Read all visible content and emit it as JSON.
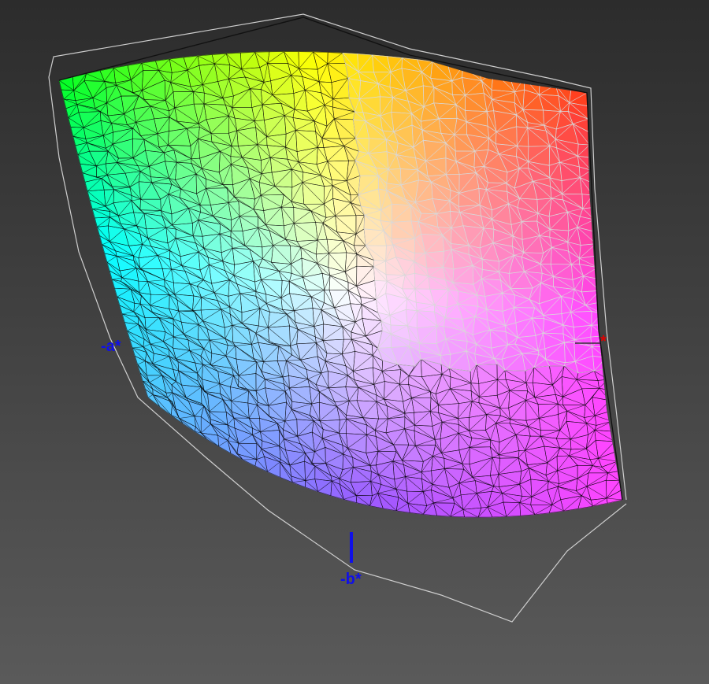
{
  "axis_labels": {
    "neg_a": "-a*",
    "pos_a": "*",
    "neg_b": "-b*"
  },
  "colors": {
    "axis": "#1010e8",
    "background_top": "#2c2c2c",
    "background_bottom": "#5a5a5a",
    "corner_green": "#00ff22",
    "corner_yellow": "#ffff00",
    "corner_red": "#ff3a1a",
    "corner_cyan": "#00ffff",
    "center_white": "#ffffff",
    "corner_magenta": "#ff44ff",
    "corner_violet": "#9a55ff",
    "corner_blue": "#55c8ff",
    "wire_dark": "#000000",
    "wire_light": "#d8d8d8"
  }
}
